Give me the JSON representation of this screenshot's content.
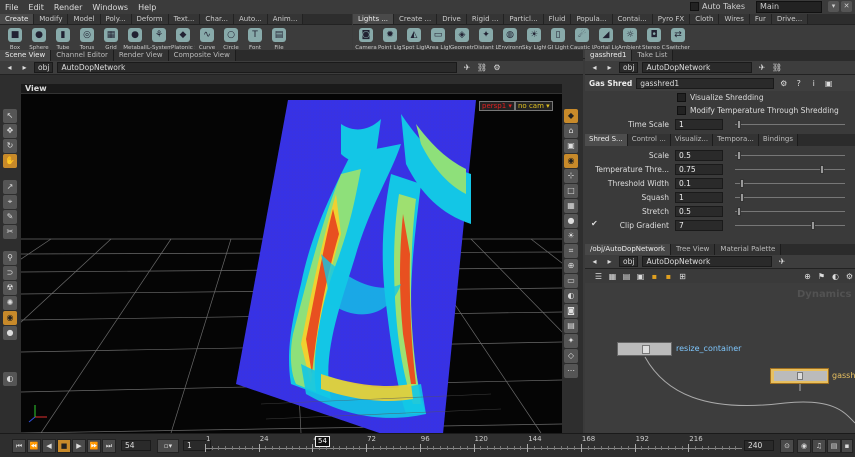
{
  "menubar": {
    "items": [
      "File",
      "Edit",
      "Render",
      "Windows",
      "Help"
    ],
    "autotakes_label": "Auto Takes",
    "main_label": "Main"
  },
  "shelf": {
    "tabs_left": [
      "Create",
      "Modify",
      "Model",
      "Poly...",
      "Deform",
      "Text...",
      "Char...",
      "Auto...",
      "Anim..."
    ],
    "tabs_right": [
      "Lights ...",
      "Create ...",
      "Drive",
      "Rigid ...",
      "Particl...",
      "Fluid",
      "Popula...",
      "Contai...",
      "Pyro FX",
      "Cloth",
      "Wires",
      "Fur",
      "Drive..."
    ],
    "tools_left": [
      {
        "label": "Box",
        "icon": "box-icon",
        "glyph": "■"
      },
      {
        "label": "Sphere",
        "icon": "sphere-icon",
        "glyph": "●"
      },
      {
        "label": "Tube",
        "icon": "tube-icon",
        "glyph": "▮"
      },
      {
        "label": "Torus",
        "icon": "torus-icon",
        "glyph": "◎"
      },
      {
        "label": "Grid",
        "icon": "grid-icon",
        "glyph": "▦"
      },
      {
        "label": "Metaball",
        "icon": "metaball-icon",
        "glyph": "●"
      },
      {
        "label": "L-System",
        "icon": "lsystem-icon",
        "glyph": "⚘"
      },
      {
        "label": "Platonic S...",
        "icon": "platonic-icon",
        "glyph": "◆"
      },
      {
        "label": "Curve",
        "icon": "curve-icon",
        "glyph": "∿"
      },
      {
        "label": "Circle",
        "icon": "circle-icon",
        "glyph": "○"
      },
      {
        "label": "Font",
        "icon": "font-icon",
        "glyph": "T"
      },
      {
        "label": "File",
        "icon": "file-icon",
        "glyph": "▤"
      }
    ],
    "tools_right": [
      {
        "label": "Camera",
        "icon": "camera-icon",
        "glyph": "◙"
      },
      {
        "label": "Point Light",
        "icon": "point-light-icon",
        "glyph": "✹"
      },
      {
        "label": "Spot Light",
        "icon": "spot-light-icon",
        "glyph": "◭"
      },
      {
        "label": "Area Light",
        "icon": "area-light-icon",
        "glyph": "▭"
      },
      {
        "label": "Geometry ...",
        "icon": "geometry-light-icon",
        "glyph": "◈"
      },
      {
        "label": "Distant Li...",
        "icon": "distant-light-icon",
        "glyph": "✦"
      },
      {
        "label": "Environm...",
        "icon": "environment-light-icon",
        "glyph": "◍"
      },
      {
        "label": "Sky Light",
        "icon": "sky-light-icon",
        "glyph": "☀"
      },
      {
        "label": "GI Light",
        "icon": "gi-light-icon",
        "glyph": "▯"
      },
      {
        "label": "Caustic Li...",
        "icon": "caustic-light-icon",
        "glyph": "☄"
      },
      {
        "label": "Portal Light",
        "icon": "portal-light-icon",
        "glyph": "◢"
      },
      {
        "label": "Ambient L...",
        "icon": "ambient-light-icon",
        "glyph": "☼"
      },
      {
        "label": "Stereo Ca...",
        "icon": "stereo-camera-icon",
        "glyph": "◘"
      },
      {
        "label": "Switcher",
        "icon": "switcher-icon",
        "glyph": "⇄"
      }
    ]
  },
  "left": {
    "tabs": [
      "Scene View",
      "Channel Editor",
      "Render View",
      "Composite View"
    ],
    "path_root": "obj",
    "path_network": "AutoDopNetwork",
    "view_label": "View",
    "persp_label": "persp1",
    "cam_label": "no cam"
  },
  "params": {
    "tabs": [
      "gasshred1",
      "Take List"
    ],
    "path_root": "obj",
    "path_network": "AutoDopNetwork",
    "node_type": "Gas Shred",
    "node_name": "gasshred1",
    "toggles": [
      "Visualize Shredding",
      "Modify Temperature Through Shredding"
    ],
    "time_scale_label": "Time Scale",
    "time_scale_value": "1",
    "folder_tabs": [
      "Shred S...",
      "Control ...",
      "Visualiz...",
      "Tempora...",
      "Bindings"
    ],
    "rows": [
      {
        "label": "Scale",
        "value": "0.5"
      },
      {
        "label": "Temperature Thre...",
        "value": "0.75"
      },
      {
        "label": "Threshold Width",
        "value": "0.1"
      },
      {
        "label": "Squash",
        "value": "1"
      },
      {
        "label": "Stretch",
        "value": "0.5"
      },
      {
        "label": "Clip Gradient",
        "value": "7"
      }
    ]
  },
  "network": {
    "tabs": [
      "/obj/AutoDopNetwork",
      "Tree View",
      "Material Palette"
    ],
    "path_root": "obj",
    "path_network": "AutoDopNetwork",
    "watermark": "Dynamics",
    "nodes": [
      {
        "label": "resize_container"
      },
      {
        "label": "gassh"
      }
    ]
  },
  "timeline": {
    "current_frame": "54",
    "step": "1",
    "end_frame": "240",
    "ticks": [
      "1",
      "24",
      "48",
      "72",
      "96",
      "120",
      "144",
      "168",
      "192",
      "216"
    ],
    "marker": "54"
  },
  "colors": {
    "accent": "#c88a2a",
    "node_active": "#e8c060",
    "viewport_bg": "#050505"
  }
}
